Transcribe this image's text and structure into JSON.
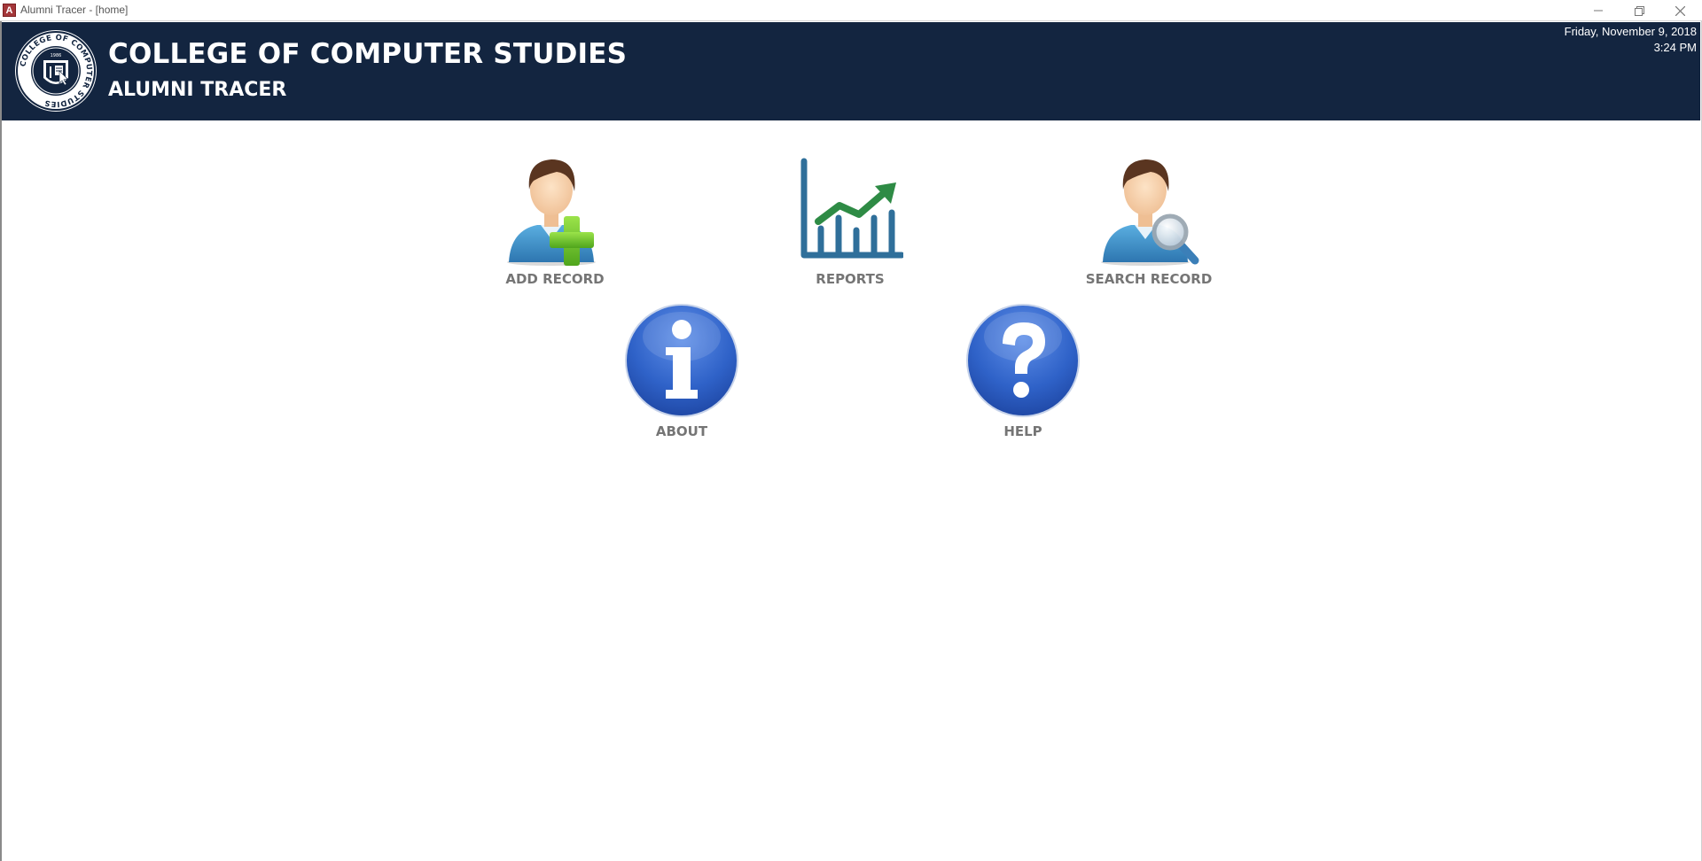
{
  "window": {
    "app_icon_letter": "A",
    "title": "Alumni Tracer - [home]",
    "controls": {
      "minimize_icon": "minimize-icon",
      "restore_icon": "restore-icon",
      "close_icon": "close-icon"
    }
  },
  "header": {
    "college_name": "COLLEGE OF COMPUTER STUDIES",
    "app_name": "ALUMNI TRACER",
    "date": "Friday, November 9, 2018",
    "time": "3:24 PM",
    "background_color": "#132540",
    "logo": {
      "ring_text": "COLLEGE OF COMPUTER STUDIES",
      "year": "1986"
    }
  },
  "menu": {
    "add_record": {
      "label": "ADD RECORD",
      "icon": "add-user-icon"
    },
    "reports": {
      "label": "REPORTS",
      "icon": "chart-icon"
    },
    "search_record": {
      "label": "SEARCH RECORD",
      "icon": "search-user-icon"
    },
    "about": {
      "label": "ABOUT",
      "icon": "info-icon"
    },
    "help": {
      "label": "HELP",
      "icon": "help-icon"
    }
  },
  "colors": {
    "label_gray": "#757575",
    "user_blue": "#3d8fc6",
    "plus_green": "#6cc22c",
    "chart_blue": "#2f6f9a",
    "chart_green": "#2e8b45",
    "circle_blue": "#2f62c8"
  }
}
